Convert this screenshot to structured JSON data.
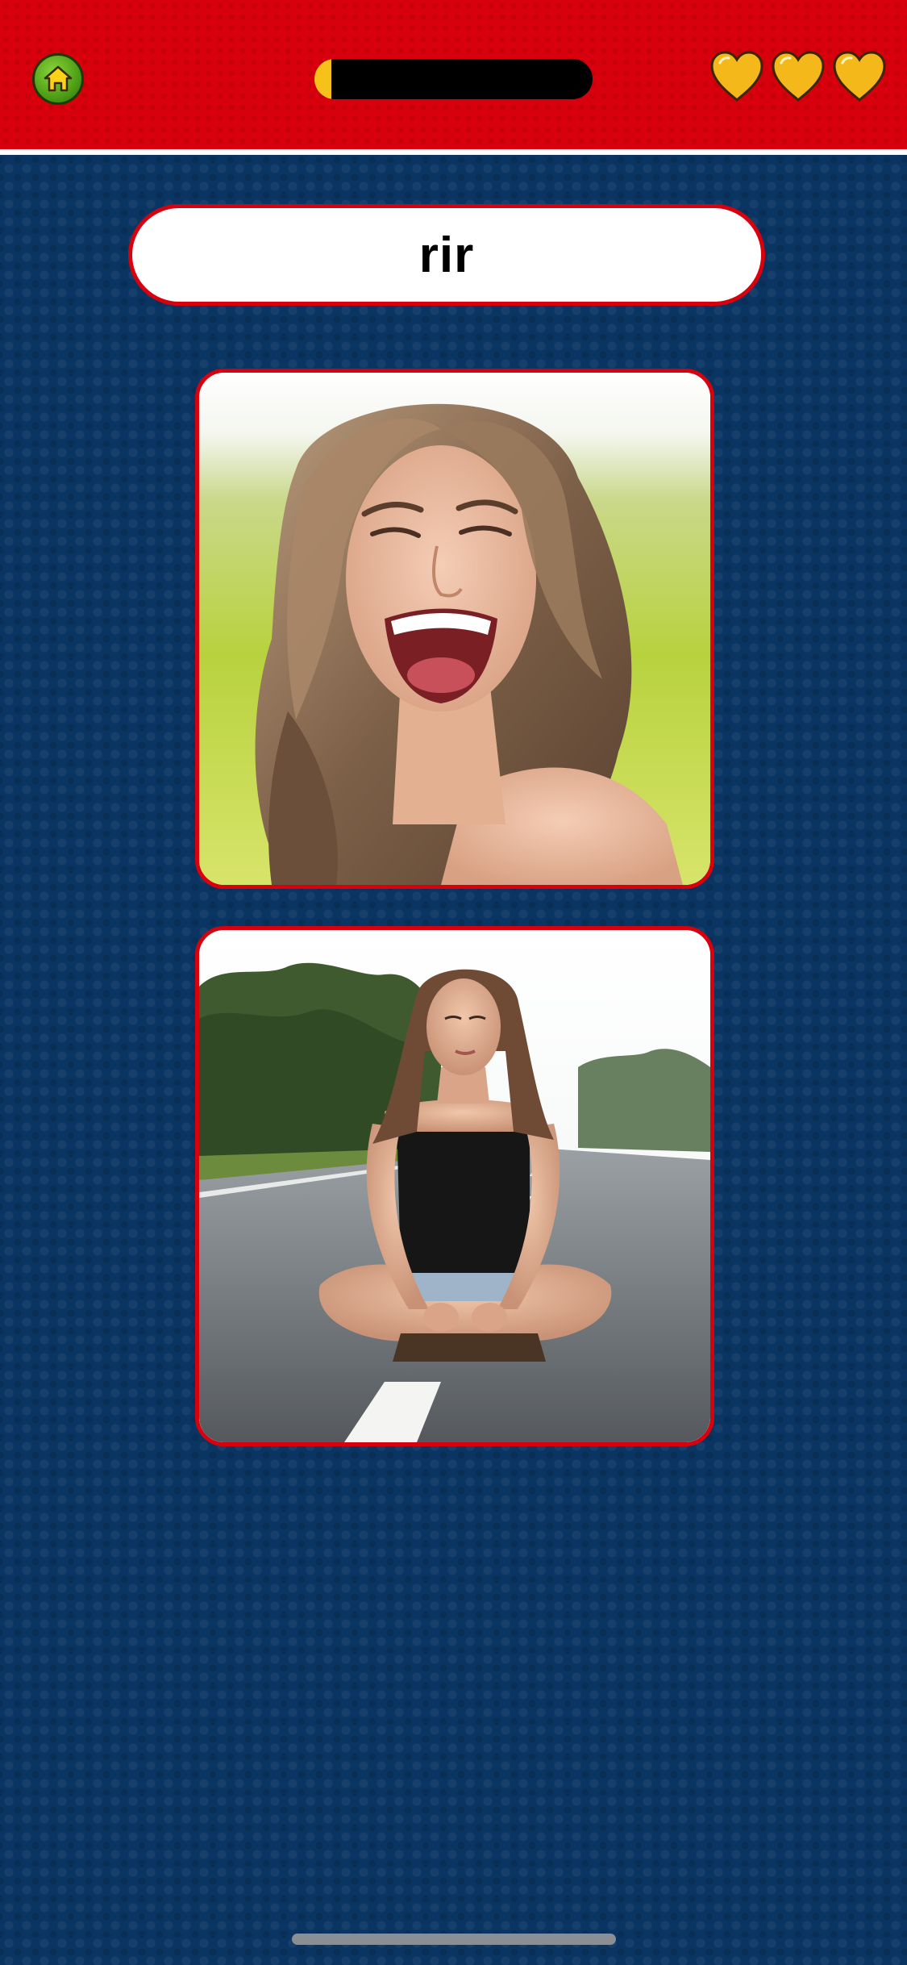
{
  "app": {
    "accent_color": "#d9000d",
    "background_color": "#0a3563"
  },
  "header": {
    "home_icon": "home-icon",
    "progress": 0.06,
    "progress_color": "#f5c11a",
    "lives": [
      {
        "icon": "heart-icon",
        "color": "#f5b81a"
      },
      {
        "icon": "heart-icon",
        "color": "#f5b81a"
      },
      {
        "icon": "heart-icon",
        "color": "#f5b81a"
      }
    ]
  },
  "question": {
    "word": "rir"
  },
  "choices": [
    {
      "image": "photo-laughing-woman"
    },
    {
      "image": "photo-woman-sitting-on-road"
    }
  ]
}
